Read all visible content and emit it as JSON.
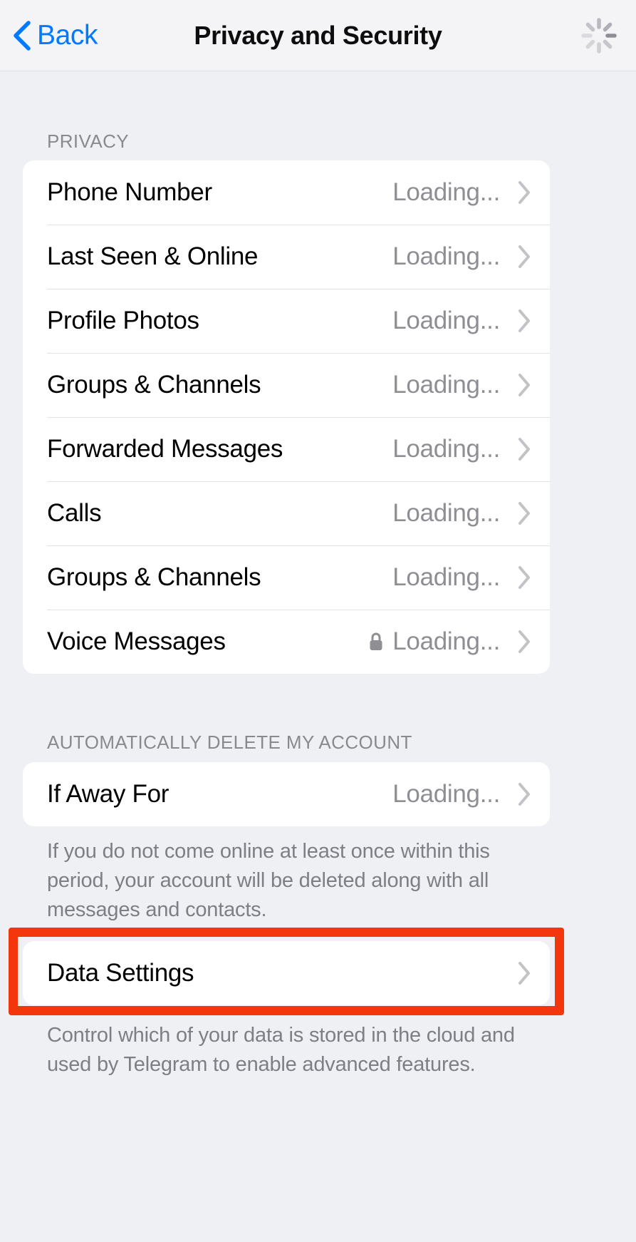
{
  "navbar": {
    "back_label": "Back",
    "title": "Privacy and Security",
    "back_icon": "chevron-left-icon",
    "activity_icon": "activity-spinner-icon"
  },
  "sections": {
    "privacy": {
      "header": "PRIVACY",
      "rows": [
        {
          "label": "Phone Number",
          "value": "Loading...",
          "lock": false
        },
        {
          "label": "Last Seen & Online",
          "value": "Loading...",
          "lock": false
        },
        {
          "label": "Profile Photos",
          "value": "Loading...",
          "lock": false
        },
        {
          "label": "Groups & Channels",
          "value": "Loading...",
          "lock": false
        },
        {
          "label": "Forwarded Messages",
          "value": "Loading...",
          "lock": false
        },
        {
          "label": "Calls",
          "value": "Loading...",
          "lock": false
        },
        {
          "label": "Groups & Channels",
          "value": "Loading...",
          "lock": false
        },
        {
          "label": "Voice Messages",
          "value": "Loading...",
          "lock": true
        }
      ]
    },
    "auto_delete": {
      "header": "AUTOMATICALLY DELETE MY ACCOUNT",
      "rows": [
        {
          "label": "If Away For",
          "value": "Loading...",
          "lock": false
        }
      ],
      "footer": "If you do not come online at least once within this period, your account will be deleted along with all messages and contacts."
    },
    "data": {
      "rows": [
        {
          "label": "Data Settings",
          "value": "",
          "lock": false
        }
      ],
      "footer": "Control which of your data is stored in the cloud and used by Telegram to enable advanced features."
    }
  },
  "colors": {
    "accent": "#007aff",
    "background": "#eff0f4",
    "card": "#ffffff",
    "secondary_text": "#8e8e93",
    "highlight": "#f4360d"
  }
}
